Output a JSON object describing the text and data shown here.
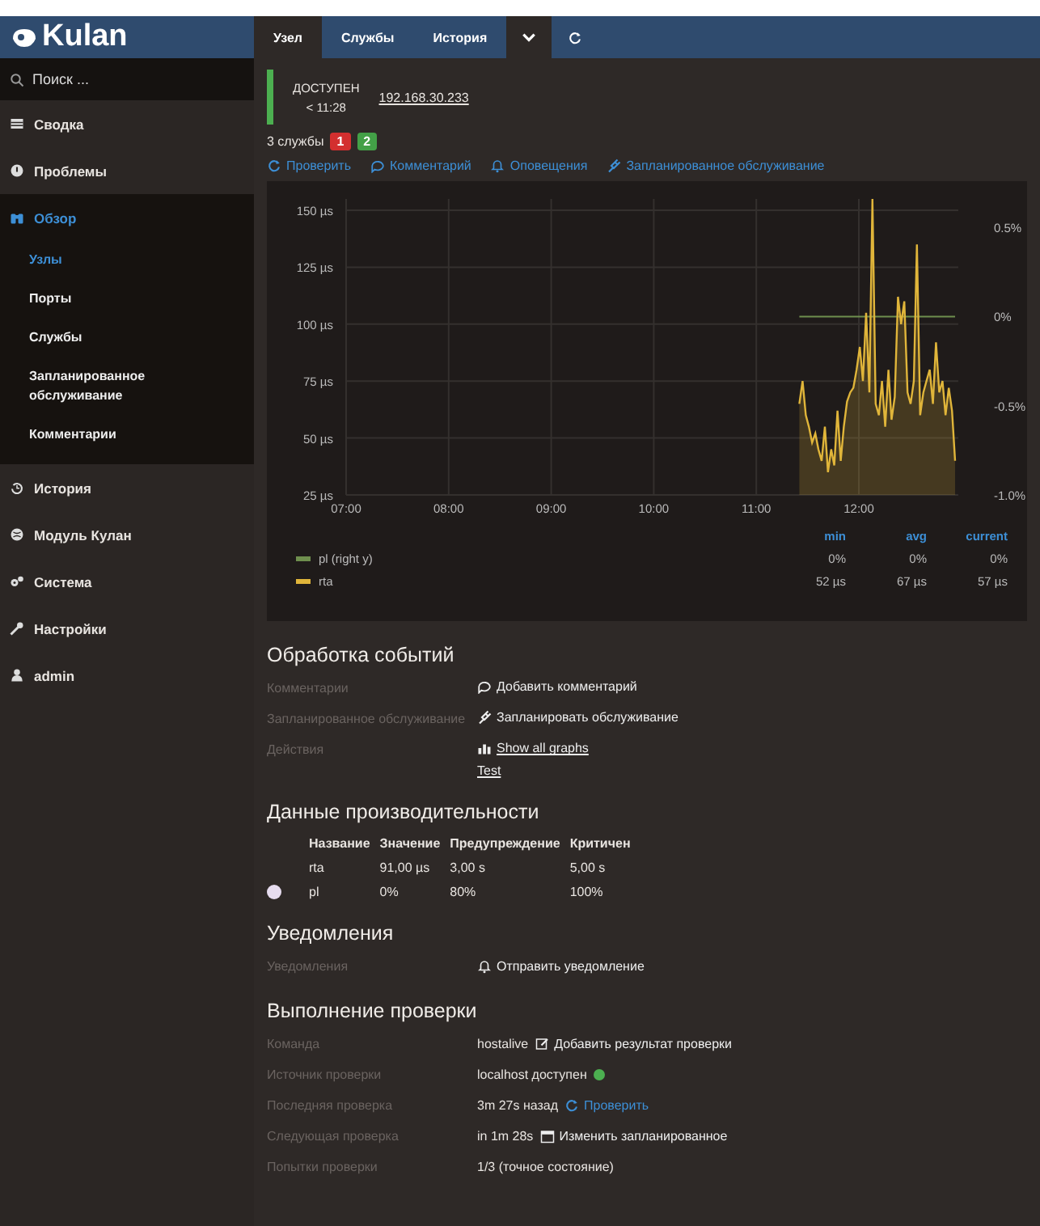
{
  "sidebar": {
    "logo": "Kulan",
    "search": {
      "placeholder": "Поиск ..."
    },
    "items": [
      {
        "label": "Сводка",
        "selected": false
      },
      {
        "label": "Проблемы",
        "selected": false
      },
      {
        "label": "Обзор",
        "selected": true,
        "expanded": true,
        "children": [
          {
            "label": "Узлы",
            "selected": true
          },
          {
            "label": "Порты",
            "selected": false
          },
          {
            "label": "Службы",
            "selected": false
          },
          {
            "label": "Запланированное обслуживание",
            "selected": false
          },
          {
            "label": "Комментарии",
            "selected": false
          }
        ]
      },
      {
        "label": "История",
        "selected": false
      },
      {
        "label": "Модуль Кулан",
        "selected": false
      },
      {
        "label": "Система",
        "selected": false
      },
      {
        "label": "Настройки",
        "selected": false
      },
      {
        "label": "admin",
        "selected": false
      }
    ]
  },
  "tabs": [
    {
      "label": "Узел",
      "selected": true
    },
    {
      "label": "Службы",
      "selected": false
    },
    {
      "label": "История",
      "selected": false
    }
  ],
  "menu_toggle": {
    "expanded": true
  },
  "host": {
    "state": "ДОСТУПЕН",
    "since": "< 11:28",
    "address": "192.168.30.233",
    "color": "#4caf50"
  },
  "services": {
    "label": "3 службы",
    "badges": [
      {
        "count": "1",
        "color": "#d32f2f"
      },
      {
        "count": "2",
        "color": "#43a047"
      }
    ]
  },
  "actions": [
    {
      "label": "Проверить"
    },
    {
      "label": "Комментарий"
    },
    {
      "label": "Оповещения"
    },
    {
      "label": "Запланированное обслуживание"
    }
  ],
  "chart": {
    "chart_data": {
      "type": "line",
      "x": [
        11.42,
        11.451,
        11.482,
        11.513,
        11.544,
        11.575,
        11.606,
        11.637,
        11.668,
        11.699,
        11.73,
        11.761,
        11.792,
        11.823,
        11.854,
        11.885,
        11.916,
        11.947,
        11.978,
        12.009,
        12.04,
        12.071,
        12.102,
        12.133,
        12.164,
        12.195,
        12.226,
        12.257,
        12.288,
        12.319,
        12.35,
        12.381,
        12.412,
        12.443,
        12.474,
        12.505,
        12.536,
        12.567,
        12.598,
        12.629,
        12.66,
        12.691,
        12.722,
        12.753,
        12.784,
        12.815,
        12.846,
        12.877,
        12.908,
        12.939
      ],
      "series": [
        {
          "name": "pl (right y)",
          "color": "#6f8f4e",
          "axis": "y2",
          "values": [
            0,
            0,
            0,
            0,
            0,
            0,
            0,
            0,
            0,
            0,
            0,
            0,
            0,
            0,
            0,
            0,
            0,
            0,
            0,
            0,
            0,
            0,
            0,
            0,
            0,
            0,
            0,
            0,
            0,
            0,
            0,
            0,
            0,
            0,
            0,
            0,
            0,
            0,
            0,
            0,
            0,
            0,
            0,
            0,
            0,
            0,
            0,
            0,
            0,
            0
          ]
        },
        {
          "name": "rta",
          "color": "#e0b53a",
          "values": [
            65,
            75,
            60,
            55,
            48,
            52,
            45,
            40,
            55,
            35,
            45,
            38,
            62,
            40,
            55,
            66,
            70,
            72,
            80,
            90,
            75,
            105,
            70,
            155,
            65,
            60,
            75,
            55,
            80,
            58,
            68,
            112,
            100,
            110,
            70,
            65,
            75,
            135,
            60,
            70,
            75,
            80,
            65,
            92,
            70,
            75,
            60,
            72,
            62,
            40
          ]
        }
      ],
      "grid": true,
      "legend": "bottom",
      "xlim": [
        7,
        12.97
      ],
      "ylim": [
        25,
        155
      ],
      "y2lim": [
        -1,
        0.66
      ],
      "xticks": [
        {
          "value": 7,
          "label": "07:00"
        },
        {
          "value": 8,
          "label": "08:00"
        },
        {
          "value": 9,
          "label": "09:00"
        },
        {
          "value": 10,
          "label": "10:00"
        },
        {
          "value": 11,
          "label": "11:00"
        },
        {
          "value": 12,
          "label": "12:00"
        }
      ],
      "yticks": [
        {
          "value": 25,
          "label": "25 µs"
        },
        {
          "value": 50,
          "label": "50 µs"
        },
        {
          "value": 75,
          "label": "75 µs"
        },
        {
          "value": 100,
          "label": "100 µs"
        },
        {
          "value": 125,
          "label": "125 µs"
        },
        {
          "value": 150,
          "label": "150 µs"
        }
      ],
      "y2ticks": [
        {
          "value": -1,
          "label": "-1.0%"
        },
        {
          "value": -0.5,
          "label": "-0.5%"
        },
        {
          "value": 0,
          "label": "0%"
        },
        {
          "value": 0.5,
          "label": "0.5%"
        }
      ]
    },
    "legend": {
      "columns": [
        "min",
        "avg",
        "current"
      ],
      "rows": [
        [
          "0%",
          "0%",
          "0%"
        ],
        [
          "52 µs",
          "67 µs",
          "57 µs"
        ]
      ]
    }
  },
  "event_handling": {
    "title": "Обработка событий",
    "rows": [
      {
        "label": "Комментарии",
        "links": [
          "Добавить комментарий"
        ]
      },
      {
        "label": "Запланированное обслуживание",
        "links": [
          "Запланировать обслуживание"
        ]
      },
      {
        "label": "Действия",
        "links": [
          "Show all graphs",
          "Test"
        ]
      }
    ]
  },
  "perfdata": {
    "title": "Данные производительности",
    "columns": [
      "Название",
      "Значение",
      "Предупреждение",
      "Критичен"
    ],
    "rows": [
      {
        "marked": false,
        "cells": [
          "rta",
          "91,00 µs",
          "3,00 s",
          "5,00 s"
        ]
      },
      {
        "marked": true,
        "cells": [
          "pl",
          "0%",
          "80%",
          "100%"
        ]
      }
    ]
  },
  "notifications": {
    "title": "Уведомления",
    "rows": [
      {
        "label": "Уведомления",
        "parts": [
          {
            "kind": "link",
            "text": "Отправить уведомление"
          }
        ]
      }
    ]
  },
  "check_execution": {
    "title": "Выполнение проверки",
    "rows": [
      {
        "label": "Команда",
        "parts": [
          {
            "kind": "text",
            "text": "hostalive"
          },
          {
            "kind": "link",
            "text": "Добавить результат проверки"
          }
        ]
      },
      {
        "label": "Источник проверки",
        "parts": [
          {
            "kind": "text",
            "text": "localhost доступен"
          },
          {
            "kind": "dot",
            "color": "#4caf50"
          }
        ]
      },
      {
        "label": "Последняя проверка",
        "parts": [
          {
            "kind": "text",
            "text": "3m 27s назад"
          },
          {
            "kind": "bluelink",
            "text": "Проверить"
          }
        ]
      },
      {
        "label": "Следующая проверка",
        "parts": [
          {
            "kind": "text",
            "text": "in 1m 28s"
          },
          {
            "kind": "link",
            "text": "Изменить запланированное"
          }
        ]
      },
      {
        "label": "Попытки проверки",
        "parts": [
          {
            "kind": "text",
            "text": "1/3 (точное состояние)"
          }
        ]
      }
    ]
  }
}
